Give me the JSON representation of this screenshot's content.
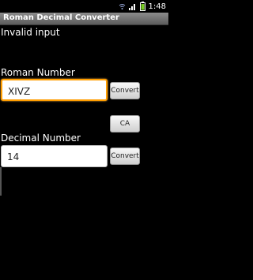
{
  "status_bar": {
    "time": "1:48",
    "icons": [
      "wifi-icon",
      "signal-icon",
      "battery-icon"
    ]
  },
  "app": {
    "title": "Roman Decimal Converter"
  },
  "message": {
    "error": "Invalid input"
  },
  "roman": {
    "label": "Roman Number",
    "value": "XIVZ",
    "button_label": "Convert"
  },
  "clear": {
    "button_label": "CA"
  },
  "decimal": {
    "label": "Decimal Number",
    "value": "14",
    "button_label": "Convert"
  },
  "colors": {
    "focus_border": "#ff9d00",
    "title_bar": "#7a7a7a"
  }
}
